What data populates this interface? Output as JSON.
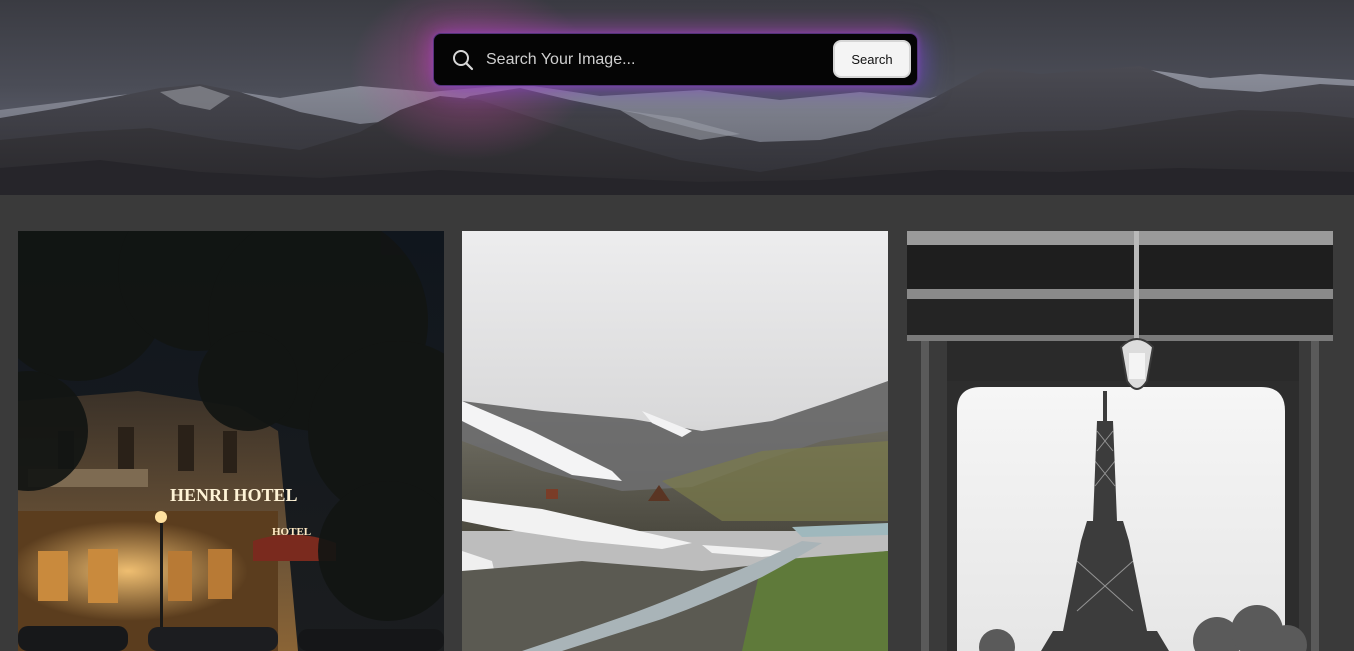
{
  "search": {
    "placeholder": "Search Your Image...",
    "button_label": "Search"
  },
  "gallery": {
    "images": [
      {
        "id": "hotel",
        "sign_text": "HENRI HOTEL",
        "awning_text": "HOTEL"
      },
      {
        "id": "mountain-valley"
      },
      {
        "id": "eiffel-tower"
      }
    ]
  },
  "colors": {
    "background": "#3a3a3a",
    "search_bg": "#050505",
    "glow_pink": "#be3caa",
    "glow_violet": "#5a50d2",
    "button_bg": "#f4f4f4"
  },
  "icons": {
    "search": "magnifier-icon"
  }
}
